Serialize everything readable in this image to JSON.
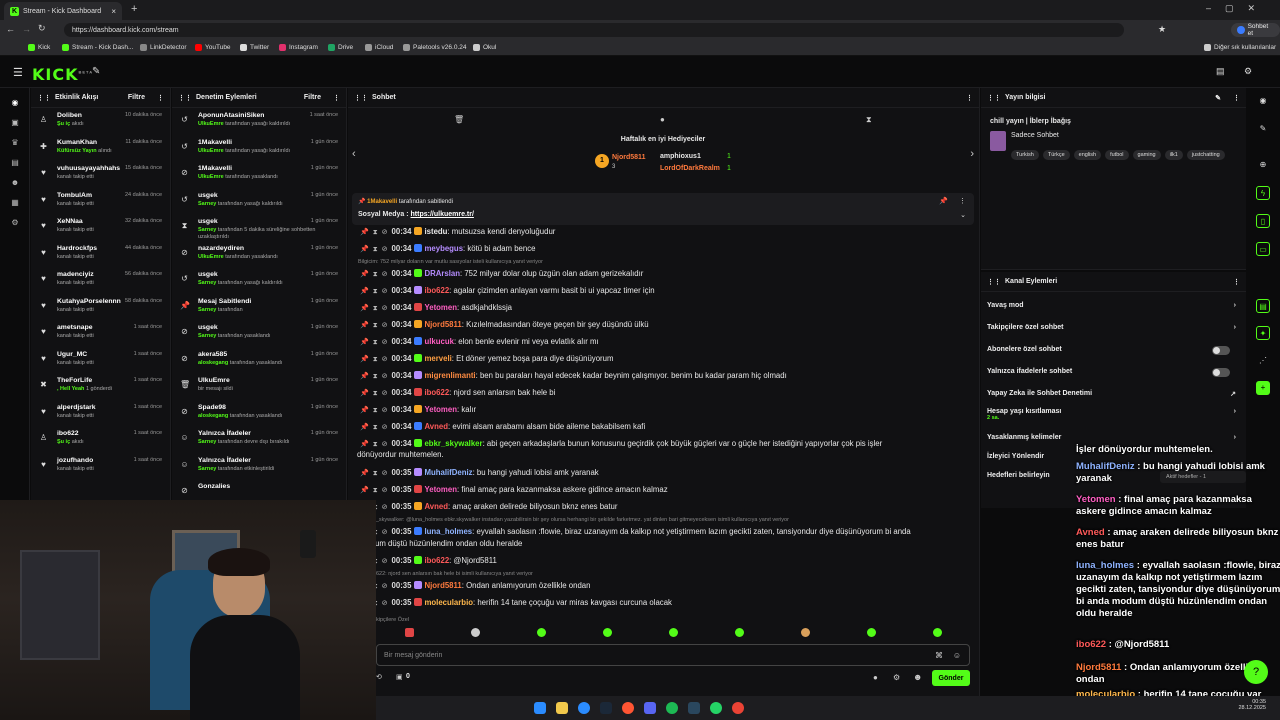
{
  "browser": {
    "tabs": [
      {
        "label": "Stream - Kick Dashboard"
      }
    ],
    "url": "https://dashboard.kick.com/stream",
    "profile_label": "Sohbet et",
    "bookmarks": [
      "Kick",
      "Stream - Kick Dash...",
      "LinkDetector",
      "YouTube",
      "Twitter",
      "Instagram",
      "Drive",
      "iCloud",
      "Paletools v26.0.24",
      "Okul"
    ],
    "other_bookmarks": "Diğer sık kullanılanlar"
  },
  "app": {
    "logo": "KICK",
    "logo_badge": "BETA"
  },
  "activity": {
    "title": "Etkinlik Akışı",
    "filter": "Filtre",
    "items": [
      {
        "name": "Doliben",
        "sub": "Şu iç",
        "sub2": "akıdı",
        "time": "10 dakika önce"
      },
      {
        "name": "KumanKhan",
        "sub": "Küfürsüz Yayın",
        "sub2": "alındı",
        "time": "11 dakika önce"
      },
      {
        "name": "vuhuusayayahhahs",
        "sub": "",
        "sub2": "kanalı takip etti",
        "time": "15 dakika önce"
      },
      {
        "name": "TombulAm",
        "sub": "",
        "sub2": "kanalı takip etti",
        "time": "24 dakika önce"
      },
      {
        "name": "XeNNaa",
        "sub": "",
        "sub2": "kanalı takip etti",
        "time": "32 dakika önce"
      },
      {
        "name": "Hardrockfps",
        "sub": "",
        "sub2": "kanalı takip etti",
        "time": "44 dakika önce"
      },
      {
        "name": "madenciyiz",
        "sub": "",
        "sub2": "kanalı takip etti",
        "time": "56 dakika önce"
      },
      {
        "name": "KutahyaPorselennn",
        "sub": "",
        "sub2": "kanalı takip etti",
        "time": "58 dakika önce"
      },
      {
        "name": "ametsnape",
        "sub": "",
        "sub2": "kanalı takip etti",
        "time": "1 saat önce"
      },
      {
        "name": "Ugur_MC",
        "sub": "",
        "sub2": "kanalı takip etti",
        "time": "1 saat önce"
      },
      {
        "name": "TheForLife",
        "sub": ", Hell Yeah",
        "sub2": "1 gönderdi",
        "time": "1 saat önce"
      },
      {
        "name": "alperdjstark",
        "sub": "",
        "sub2": "kanalı takip etti",
        "time": "1 saat önce"
      },
      {
        "name": "ibo622",
        "sub": "Şu iç",
        "sub2": "akıdı",
        "time": "1 saat önce"
      },
      {
        "name": "jozufhando",
        "sub": "",
        "sub2": "kanalı takip etti",
        "time": "1 saat önce"
      }
    ]
  },
  "moderation": {
    "title": "Denetim Eylemleri",
    "filter": "Filtre",
    "items": [
      {
        "name": "AponunAtasiniSiken",
        "by": "UlkuEmre",
        "action": "tarafından yasağı kaldırıldı",
        "time": "1 saat önce"
      },
      {
        "name": "1Makavelli",
        "by": "UlkuEmre",
        "action": "tarafından yasağı kaldırıldı",
        "time": "1 gün önce"
      },
      {
        "name": "1Makavelli",
        "by": "UlkuEmre",
        "action": "tarafından yasaklandı",
        "time": "1 gün önce"
      },
      {
        "name": "usgek",
        "by": "Sarney",
        "action": "tarafından yasağı kaldırıldı",
        "time": "1 gün önce"
      },
      {
        "name": "usgek",
        "by": "Sarney",
        "action": "tarafından 5 dakika süreliğine sohbetten uzaklaştırıldı",
        "time": "1 gün önce"
      },
      {
        "name": "nazardeydiren",
        "by": "UlkuEmre",
        "action": "tarafından yasaklandı",
        "time": "1 gün önce"
      },
      {
        "name": "usgek",
        "by": "Sarney",
        "action": "tarafından yasağı kaldırıldı",
        "time": "1 gün önce"
      },
      {
        "name": "Mesaj Sabitlendi",
        "by": "Sarney",
        "action": "tarafından",
        "time": "1 gün önce"
      },
      {
        "name": "usgek",
        "by": "Sarney",
        "action": "tarafından yasaklandı",
        "time": "1 gün önce"
      },
      {
        "name": "akera585",
        "by": "aloskegang",
        "action": "tarafından yasaklandı",
        "time": "1 gün önce"
      },
      {
        "name": "UlkuEmre",
        "by": "",
        "action": "bir mesajı sildi",
        "time": "1 gün önce"
      },
      {
        "name": "Spade98",
        "by": "aloskegang",
        "action": "tarafından yasaklandı",
        "time": "1 gün önce"
      },
      {
        "name": "Yalnızca İfadeler",
        "by": "Sarney",
        "action": "tarafından devre dışı bırakıldı",
        "time": "1 gün önce"
      },
      {
        "name": "Yalnızca İfadeler",
        "by": "Sarney",
        "action": "tarafından etkinleştirildi",
        "time": "1 gün önce"
      },
      {
        "name": "Gonzalies",
        "by": "",
        "action": "",
        "time": ""
      }
    ]
  },
  "chat": {
    "title": "Sohbet",
    "gifters_title": "Haftalık en iyi Hediyeciler",
    "gifters": [
      {
        "name": "Njord5811",
        "count": "3"
      },
      {
        "name": "amphioxus1",
        "count": "1"
      },
      {
        "name": "LordOfDarkRealm",
        "count": "1"
      }
    ],
    "pinned_by": "1Makavelli",
    "pinned_label": "tarafından sabitlendi",
    "pinned_text": "Sosyal Medya :",
    "pinned_link": "https://ulkuemre.tr/",
    "messages": [
      {
        "time": "00:34",
        "user": "istedu",
        "color": "#e8e8e8",
        "text": "mutsuzsa kendi denyoluğudur"
      },
      {
        "time": "00:34",
        "user": "meybegus",
        "color": "#b58cff",
        "text": "kötü bi adam bence"
      },
      {
        "time": "00:34",
        "user": "DRArslan",
        "color": "#b58cff",
        "text": "752 milyar dolar olup üzgün olan adam gerizekalıdır"
      },
      {
        "time": "00:34",
        "user": "ibo622",
        "color": "#ff5a5a",
        "text": "agalar çizimden anlayan varmı basit bi ui yapcaz timer için"
      },
      {
        "time": "00:34",
        "user": "Yetomen",
        "color": "#ff5fc3",
        "text": "asdkjahdklssja"
      },
      {
        "time": "00:34",
        "user": "Njord5811",
        "color": "#ff7a3d",
        "text": "Kızılelmadasından öteye geçen bir şey düşündü ülkü"
      },
      {
        "time": "00:34",
        "user": "ulkucuk",
        "color": "#ff5fc3",
        "text": "elon benle evlenir mi veya evlatlık alır mı"
      },
      {
        "time": "00:34",
        "user": "merveli",
        "color": "#ff9f43",
        "text": "Et döner yemez boşa para diye düşünüyorum"
      },
      {
        "time": "00:34",
        "user": "migrenlimanti",
        "color": "#ff8c42",
        "text": "ben bu paraları hayal edecek kadar beynim çalışmıyor. benim bu kadar param hiç olmadı"
      },
      {
        "time": "00:34",
        "user": "ibo622",
        "color": "#ff5a5a",
        "text": "njord sen anlarsın bak hele bi"
      },
      {
        "time": "00:34",
        "user": "Yetomen",
        "color": "#ff5fc3",
        "text": "kalır"
      },
      {
        "time": "00:34",
        "user": "Avned",
        "color": "#ff5a5a",
        "text": "evimi alsam arabamı alsam bide aileme bakabilsem kafi"
      },
      {
        "time": "00:34",
        "user": "ebkr_skywalker",
        "color": "#53fc18",
        "text": "abi geçen arkadaşlarla bunun konusunu geçirdik çok büyük güçleri var o güçle her istediğini yapıyorlar çok pis işler"
      },
      {
        "time": "00:35",
        "user": "MuhalifDeniz",
        "color": "#8fb3ff",
        "text": "bu hangi yahudi lobisi amk yaranak"
      },
      {
        "time": "00:35",
        "user": "Yetomen",
        "color": "#ff5fc3",
        "text": "final amaç para kazanmaksa askere gidince amacın kalmaz"
      },
      {
        "time": "00:35",
        "user": "Avned",
        "color": "#ff5a5a",
        "text": "amaç araken delirede biliyosun bknz enes batur"
      },
      {
        "time": "00:35",
        "user": "luna_holmes",
        "color": "#8fb3ff",
        "text": "eyvallah saolasın :flowie, biraz uzanayım da kalkıp not yetiştirmem lazım gecikti zaten, tansiyondur diye düşünüyorum bi anda"
      },
      {
        "time": "00:35",
        "user": "ibo622",
        "color": "#ff5a5a",
        "text": "@Njord5811"
      },
      {
        "time": "00:35",
        "user": "Njord5811",
        "color": "#ff7a3d",
        "text": "Ondan anlamıyorum özellikle ondan"
      },
      {
        "time": "00:35",
        "user": "molecularbio",
        "color": "#ffb84d",
        "text": "herifin 14 tane çoçuğu var miras kavgası curcuna olacak"
      }
    ],
    "continuation_1": "dönüyordur muhtemelen.",
    "continuation_2": "um düştü hüzünlendim ondan oldu heralde",
    "reply_note_1": "Bilgicim: 752 milyar doların var mutlu sasıyolar isteli kullanıcıya yanıt veriyor",
    "reply_note_2": "r_skywalker: @luna_holmes ebkr.skywalker instadan yazabilirsin bir şey olursa herhangi bir şekilde farketmez. yat dinlen bari gitmeyeceksen isimli kullanıcıya yanıt veriyor",
    "reply_note_3": "622: njord sen anlarsın bak hele bi isimli kullanıcıya yanıt veriyor",
    "followers_only": "kipçilere Özel",
    "input_placeholder": "Bir mesaj gönderin",
    "viewer_count": "0",
    "send_label": "Gönder"
  },
  "stream_info": {
    "title": "Yayın bilgisi",
    "stream_title": "chill yayın | İblerp İbağış",
    "category": "Sadece Sohbet",
    "tags": [
      "Turkish",
      "Türkçe",
      "english",
      "futbol",
      "gaming",
      "ilk1",
      "justchatting"
    ]
  },
  "channel_actions": {
    "title": "Kanal Eylemleri",
    "rows": [
      {
        "label": "Yavaş mod",
        "kind": "chevron"
      },
      {
        "label": "Takipçilere özel sohbet",
        "kind": "chevron"
      },
      {
        "label": "Abonelere özel sohbet",
        "kind": "toggle"
      },
      {
        "label": "Yalnızca ifadelerle sohbet",
        "kind": "toggle"
      },
      {
        "label": "Yapay Zeka ile Sohbet Denetimi",
        "kind": "link"
      },
      {
        "label": "Hesap yaşı kısıtlaması",
        "sub": "2 sa.",
        "kind": "chevron"
      },
      {
        "label": "Yasaklanmış kelimeler",
        "kind": "chevron"
      },
      {
        "label": "İzleyici Yönlendir",
        "kind": "none"
      },
      {
        "label": "Hedefleri belirleyin",
        "kind": "none"
      }
    ]
  },
  "overlay_chat": [
    {
      "user": "",
      "text": "İşler dönüyordur muhtemelen."
    },
    {
      "user": "MuhalifDeniz",
      "color": "#8fb3ff",
      "text": " : bu hangi yahudi lobisi amk yaranak"
    },
    {
      "user": "Yetomen",
      "color": "#ff5fc3",
      "text": " : final amaç para kazanmaksa askere gidince amacın kalmaz"
    },
    {
      "user": "Avned",
      "color": "#ff5a5a",
      "text": " : amaç araken delirede biliyosun bknz enes batur"
    },
    {
      "user": "luna_holmes",
      "color": "#8fb3ff",
      "text": " : eyvallah saolasın :flowie, biraz uzanayım da kalkıp not yetiştirmem lazım gecikti zaten, tansiyondur diye düşünüyorum bi anda modum düştü hüzünlendim ondan oldu heralde"
    },
    {
      "user": "ibo622",
      "color": "#ff5a5a",
      "text": " : @Njord5811"
    },
    {
      "user": "Njord5811",
      "color": "#ff7a3d",
      "text": " : Ondan anlamıyorum özellikle ondan"
    },
    {
      "user": "molecularbio",
      "color": "#ffb84d",
      "text": " : herifin 14 tane çoçuğu var miras kavgası curcuna olacak"
    }
  ],
  "goal_popup": "Aktif hedefler - 1",
  "taskbar": {
    "time": "00:35",
    "date": "28.12.2025"
  },
  "colors": {
    "accent": "#53fc18",
    "bg": "#0b0b0c",
    "panel": "#111113"
  }
}
